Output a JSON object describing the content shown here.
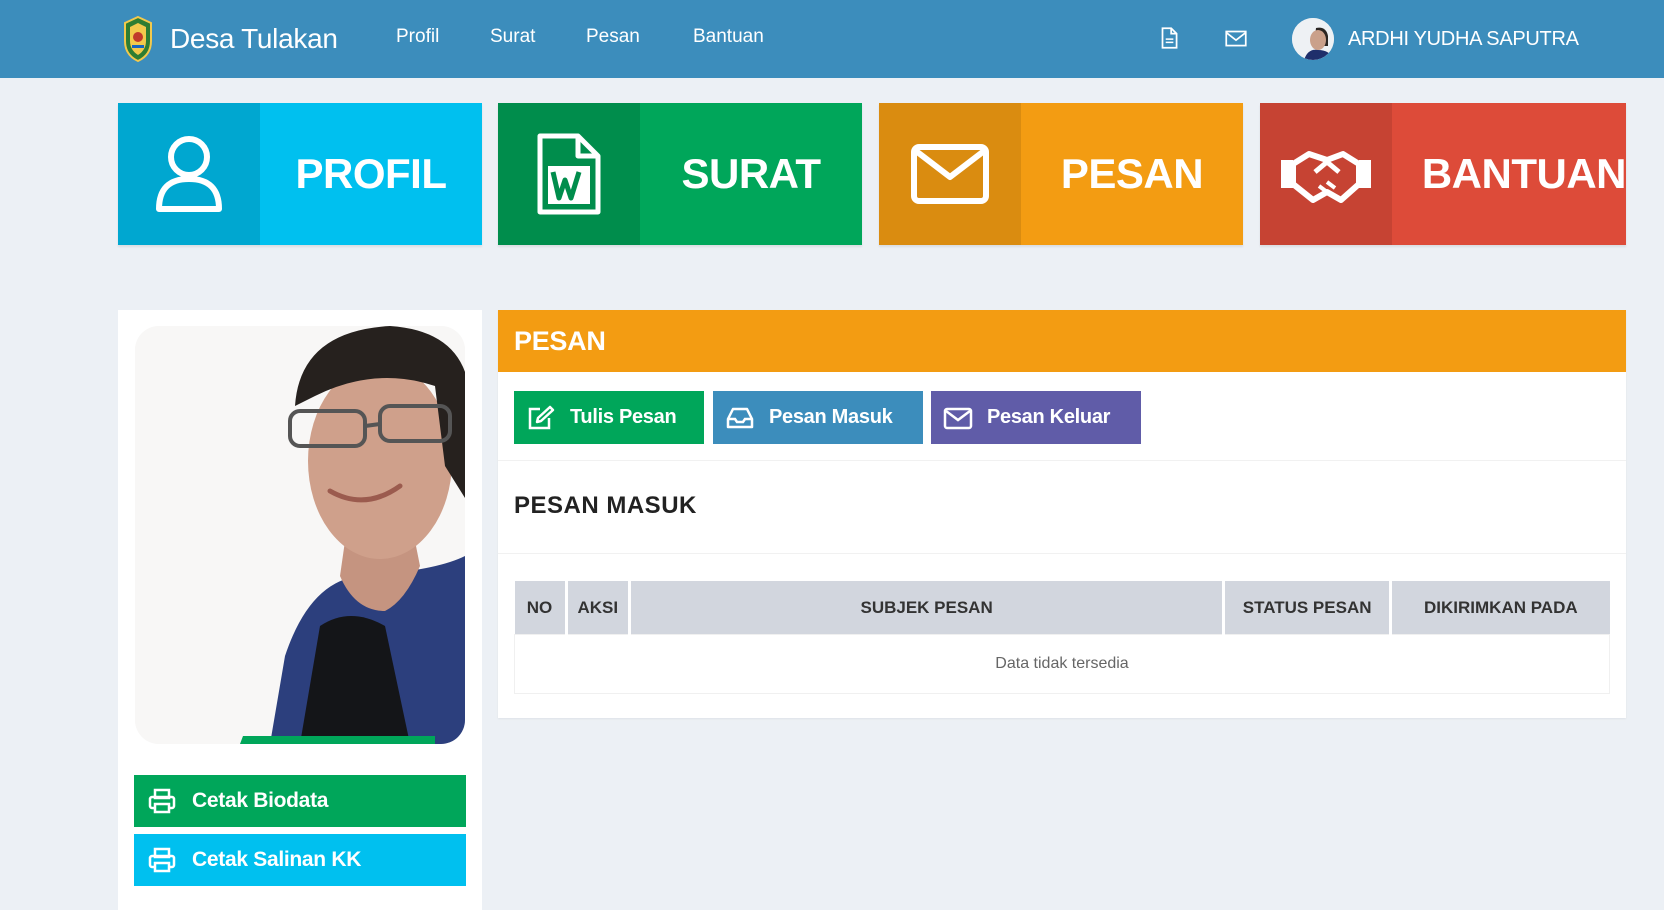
{
  "header": {
    "brand_name": "Desa Tulakan",
    "nav": [
      "Profil",
      "Surat",
      "Pesan",
      "Bantuan"
    ],
    "icons": [
      "file-icon",
      "envelope-icon"
    ],
    "user_name": "ARDHI YUDHA SAPUTRA"
  },
  "tiles": [
    {
      "label": "PROFIL",
      "icon": "user-icon",
      "color": "#00c0ef",
      "icon_bg": "#00a7d0"
    },
    {
      "label": "SURAT",
      "icon": "word-file-icon",
      "color": "#00a65a",
      "icon_bg": "#008d4c"
    },
    {
      "label": "PESAN",
      "icon": "envelope-icon",
      "color": "#f39c12",
      "icon_bg": "#da8c10"
    },
    {
      "label": "BANTUAN",
      "icon": "handshake-icon",
      "color": "#dd4b39",
      "icon_bg": "#c64333"
    }
  ],
  "sidebar": {
    "buttons": [
      {
        "label": "Cetak Biodata",
        "icon": "print-icon",
        "color": "#00a65a"
      },
      {
        "label": "Cetak Salinan KK",
        "icon": "print-icon",
        "color": "#00c0ef"
      }
    ]
  },
  "messages": {
    "panel_title": "PESAN",
    "buttons": [
      {
        "label": "Tulis Pesan",
        "icon": "edit-icon",
        "color": "#00a65a"
      },
      {
        "label": "Pesan Masuk",
        "icon": "inbox-icon",
        "color": "#3c8dbc"
      },
      {
        "label": "Pesan Keluar",
        "icon": "envelope-icon",
        "color": "#605ca8"
      }
    ],
    "section_title": "PESAN MASUK",
    "table": {
      "columns": [
        "NO",
        "AKSI",
        "SUBJEK PESAN",
        "STATUS PESAN",
        "DIKIRIMKAN PADA"
      ],
      "empty_text": "Data tidak tersedia"
    }
  }
}
